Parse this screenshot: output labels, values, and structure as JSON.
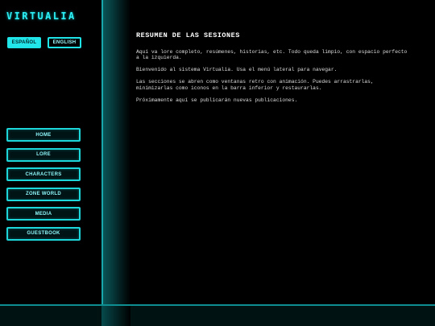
{
  "app": {
    "logo_text": "VIRTUALIA"
  },
  "languages": [
    {
      "label": "ESPAÑOL",
      "active": true
    },
    {
      "label": "ENGLISH",
      "active": false
    }
  ],
  "nav": {
    "items": [
      {
        "label": "HOME"
      },
      {
        "label": "LORE"
      },
      {
        "label": "CHARACTERS"
      },
      {
        "label": "ZONE WORLD"
      },
      {
        "label": "MEDIA"
      },
      {
        "label": "GUESTBOOK"
      }
    ]
  },
  "main": {
    "title": "RESUMEN DE LAS SESIONES",
    "paragraphs": [
      "Aquí va lore completo, resúmenes, historias, etc. Todo queda limpio, con espacio perfecto a la izquierda.",
      "Bienvenido al sistema Virtualia. Usa el menú lateral para navegar.",
      "Las secciones se abren como ventanas retro con animación. Puedes arrastrarlas, minimizarlas como iconos en la barra inferior y restaurarlas.",
      "Próximamente aquí se publicarán nuevas publicaciones."
    ]
  },
  "colors": {
    "accent": "#22e6ea",
    "background": "#000000",
    "taskbar": "#011213"
  }
}
